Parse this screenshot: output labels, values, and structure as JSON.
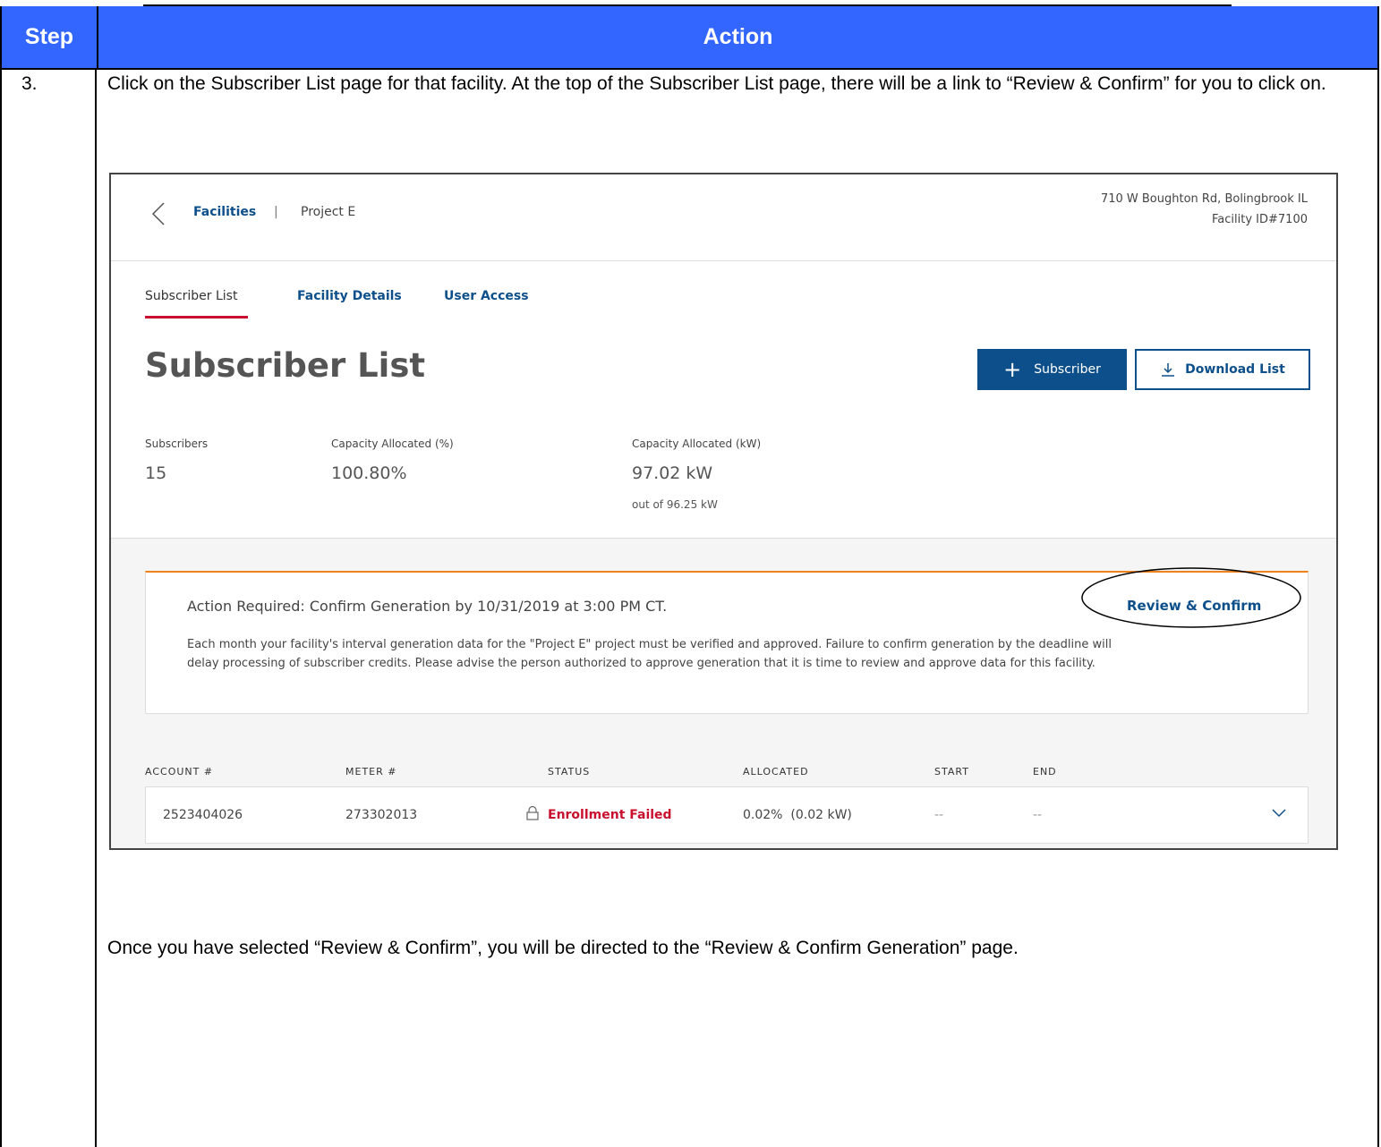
{
  "doc": {
    "header_step": "Step",
    "header_action": "Action",
    "step_number": "3.",
    "instruction": "Click on the Subscriber List page for that facility.  At the top of the Subscriber List page, there will be a link to “Review & Confirm” for you to click on.",
    "note": "Once you have selected “Review & Confirm”, you will be directed to the “Review & Confirm Generation” page."
  },
  "screen": {
    "breadcrumb": {
      "facilities": "Facilities",
      "separator": "|",
      "project": "Project E"
    },
    "address": "710 W Boughton Rd, Bolingbrook IL",
    "facility_id": "Facility ID#7100",
    "tabs": [
      {
        "label": "Subscriber List"
      },
      {
        "label": "Facility Details"
      },
      {
        "label": "User Access"
      }
    ],
    "page_title": "Subscriber List",
    "buttons": {
      "add_subscriber": "Subscriber",
      "download_list": "Download List"
    },
    "stats": [
      {
        "label": "Subscribers",
        "value": "15"
      },
      {
        "label": "Capacity Allocated (%)",
        "value": "100.80%"
      },
      {
        "label": "Capacity Allocated (kW)",
        "value": "97.02 kW",
        "sub": "out of 96.25 kW"
      }
    ],
    "alert": {
      "title": "Action Required: Confirm Generation by 10/31/2019 at 3:00 PM CT.",
      "link": "Review & Confirm",
      "body": "Each month your facility's interval generation data for the \"Project E\" project must be verified and approved.  Failure to confirm generation by the deadline will delay processing of subscriber credits.  Please advise the person authorized to approve generation that it is time to review and approve data for this facility."
    },
    "table": {
      "headers": [
        "ACCOUNT #",
        "METER #",
        "STATUS",
        "ALLOCATED",
        "START",
        "END"
      ],
      "rows": [
        {
          "account": "2523404026",
          "meter": "273302013",
          "status": "Enrollment Failed",
          "allocated": "0.02%  (0.02 kW)",
          "start": "--",
          "end": "--"
        }
      ]
    },
    "colors": {
      "primary": "#0d4f8b",
      "accent_red": "#c8102e",
      "alert_orange": "#f0821e",
      "header_blue": "#3366ff"
    }
  }
}
